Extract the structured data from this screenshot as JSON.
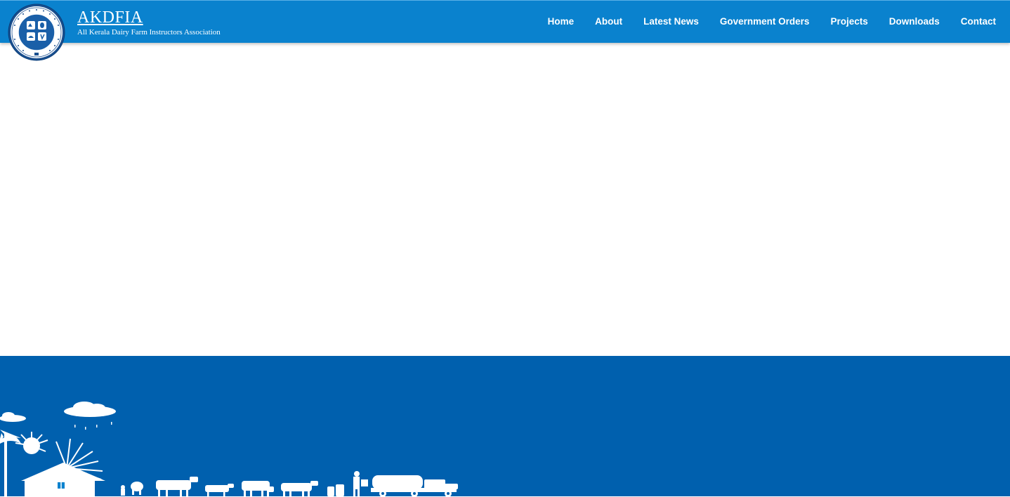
{
  "brand": {
    "title": "AKDFIA",
    "subtitle": "All Kerala Dairy Farm Instructors Association"
  },
  "nav": {
    "items": [
      {
        "label": "Home"
      },
      {
        "label": "About"
      },
      {
        "label": "Latest News"
      },
      {
        "label": "Government Orders"
      },
      {
        "label": "Projects"
      },
      {
        "label": "Downloads"
      },
      {
        "label": "Contact"
      }
    ]
  },
  "colors": {
    "header": "#0a82ce",
    "footer": "#0060ae",
    "text": "#ffffff"
  },
  "icons": {
    "logo": "association-seal-icon",
    "footer_art": "dairy-farm-silhouette"
  }
}
